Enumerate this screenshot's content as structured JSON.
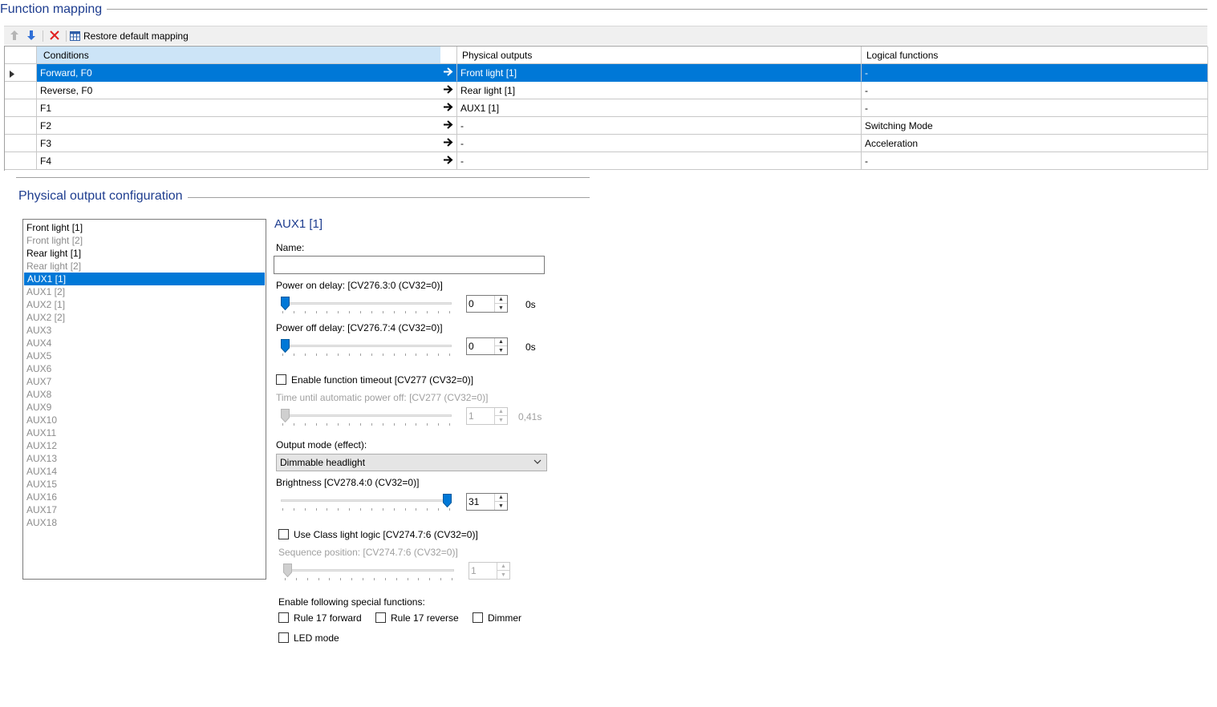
{
  "function_mapping": {
    "title": "Function mapping",
    "toolbar": {
      "move_up_icon": "arrow-up-icon",
      "move_down_icon": "arrow-down-icon",
      "delete_icon": "close-icon",
      "restore_label": "Restore default mapping"
    },
    "columns": [
      "Conditions",
      "Physical outputs",
      "Logical functions"
    ],
    "rows": [
      {
        "condition": "Forward, F0",
        "output": "Front light [1]",
        "logical": "-",
        "selected": true
      },
      {
        "condition": "Reverse, F0",
        "output": "Rear light [1]",
        "logical": "-"
      },
      {
        "condition": "F1",
        "output": "AUX1 [1]",
        "logical": "-"
      },
      {
        "condition": "F2",
        "output": "-",
        "logical": "Switching Mode"
      },
      {
        "condition": "F3",
        "output": "-",
        "logical": "Acceleration"
      },
      {
        "condition": "F4",
        "output": "-",
        "logical": "-"
      }
    ]
  },
  "physical_output": {
    "title": "Physical output configuration",
    "outputs": [
      {
        "label": "Front light [1]",
        "active": true
      },
      {
        "label": "Front light [2]",
        "active": false
      },
      {
        "label": "Rear light [1]",
        "active": true
      },
      {
        "label": "Rear light [2]",
        "active": false
      },
      {
        "label": "AUX1 [1]",
        "active": true,
        "selected": true
      },
      {
        "label": "AUX1 [2]",
        "active": false
      },
      {
        "label": "AUX2 [1]",
        "active": false
      },
      {
        "label": "AUX2 [2]",
        "active": false
      },
      {
        "label": "AUX3",
        "active": false
      },
      {
        "label": "AUX4",
        "active": false
      },
      {
        "label": "AUX5",
        "active": false
      },
      {
        "label": "AUX6",
        "active": false
      },
      {
        "label": "AUX7",
        "active": false
      },
      {
        "label": "AUX8",
        "active": false
      },
      {
        "label": "AUX9",
        "active": false
      },
      {
        "label": "AUX10",
        "active": false
      },
      {
        "label": "AUX11",
        "active": false
      },
      {
        "label": "AUX12",
        "active": false
      },
      {
        "label": "AUX13",
        "active": false
      },
      {
        "label": "AUX14",
        "active": false
      },
      {
        "label": "AUX15",
        "active": false
      },
      {
        "label": "AUX16",
        "active": false
      },
      {
        "label": "AUX17",
        "active": false
      },
      {
        "label": "AUX18",
        "active": false
      }
    ],
    "detail": {
      "heading": "AUX1 [1]",
      "name_label": "Name:",
      "name_value": "",
      "power_on": {
        "label": "Power on delay: [CV276.3:0 (CV32=0)]",
        "value": "0",
        "unit": "0s",
        "level": 0
      },
      "power_off": {
        "label": "Power off delay: [CV276.7:4 (CV32=0)]",
        "value": "0",
        "unit": "0s",
        "level": 0
      },
      "timeout_check_label": "Enable function timeout [CV277 (CV32=0)]",
      "auto_off": {
        "label": "Time until automatic power off: [CV277 (CV32=0)]",
        "value": "1",
        "unit": "0,41s",
        "level": 0
      },
      "output_mode_label": "Output mode (effect):",
      "output_mode_value": "Dimmable headlight",
      "brightness": {
        "label": "Brightness [CV278.4:0 (CV32=0)]",
        "value": "31",
        "level": 1.0
      },
      "class_light_label": "Use Class light logic [CV274.7:6 (CV32=0)]",
      "sequence": {
        "label": "Sequence position: [CV274.7:6 (CV32=0)]",
        "value": "1",
        "level": 0
      },
      "special_label": "Enable following special functions:",
      "special_functions": [
        "Rule 17 forward",
        "Rule 17 reverse",
        "Dimmer",
        "LED mode"
      ]
    }
  }
}
